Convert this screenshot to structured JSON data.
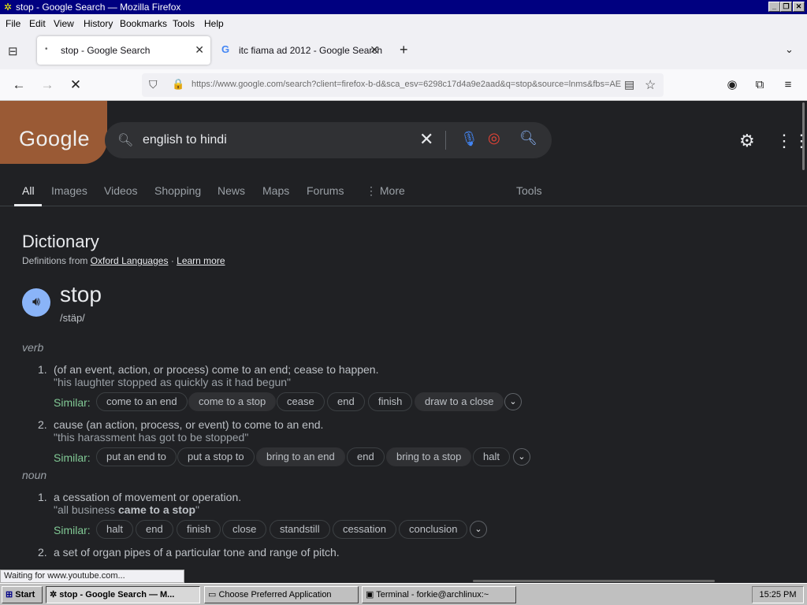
{
  "window": {
    "title": "stop - Google Search — Mozilla Firefox",
    "controls": [
      "_",
      "❐",
      "✕"
    ]
  },
  "menu": [
    "File",
    "Edit",
    "View",
    "History",
    "Bookmarks",
    "Tools",
    "Help"
  ],
  "tabs": [
    {
      "label": "stop - Google Search",
      "active": true
    },
    {
      "label": "itc fiama ad 2012 - Google Search",
      "active": false
    }
  ],
  "navbar": {
    "url": "https://www.google.com/search?client=firefox-b-d&sca_esv=6298c17d4a9e2aad&q=stop&source=lnms&fbs=AEQN"
  },
  "google": {
    "logo": "Google",
    "query": "english to hindi",
    "nav_tabs": [
      "All",
      "Images",
      "Videos",
      "Shopping",
      "News",
      "Maps",
      "Forums",
      "⋮ More"
    ],
    "tools": "Tools"
  },
  "dictionary": {
    "title": "Dictionary",
    "source_prefix": "Definitions from",
    "source": "Oxford Languages",
    "separator": "·",
    "learn_more": "Learn more",
    "word": "stop",
    "phonetic": "/stäp/",
    "verb_label": "verb",
    "noun_label": "noun",
    "similar_label": "Similar:",
    "senses": [
      {
        "num": "1.",
        "def": "(of an event, action, or process) come to an end; cease to happen.",
        "example": "\"his laughter stopped as quickly as it had begun\"",
        "similar": [
          "come to an end",
          "come to a stop",
          "cease",
          "end",
          "finish",
          "draw to a close"
        ]
      },
      {
        "num": "2.",
        "def": "cause (an action, process, or event) to come to an end.",
        "example": "\"this harassment has got to be stopped\"",
        "similar": [
          "put an end to",
          "put a stop to",
          "bring to an end",
          "end",
          "bring to a stop",
          "halt"
        ]
      },
      {
        "num": "1.",
        "def": "a cessation of movement or operation.",
        "example_pre": "\"all business ",
        "example_bold": "came to a stop",
        "example_post": "\"",
        "similar": [
          "halt",
          "end",
          "finish",
          "close",
          "standstill",
          "cessation",
          "conclusion"
        ]
      },
      {
        "num": "2.",
        "def": "a set of organ pipes of a particular tone and range of pitch."
      }
    ]
  },
  "status": "Waiting for www.youtube.com...",
  "taskbar": {
    "start": "Start",
    "items": [
      "stop - Google Search — M...",
      "Choose Preferred Application",
      "Terminal - forkie@archlinux:~"
    ],
    "clock": "15:25 PM"
  }
}
